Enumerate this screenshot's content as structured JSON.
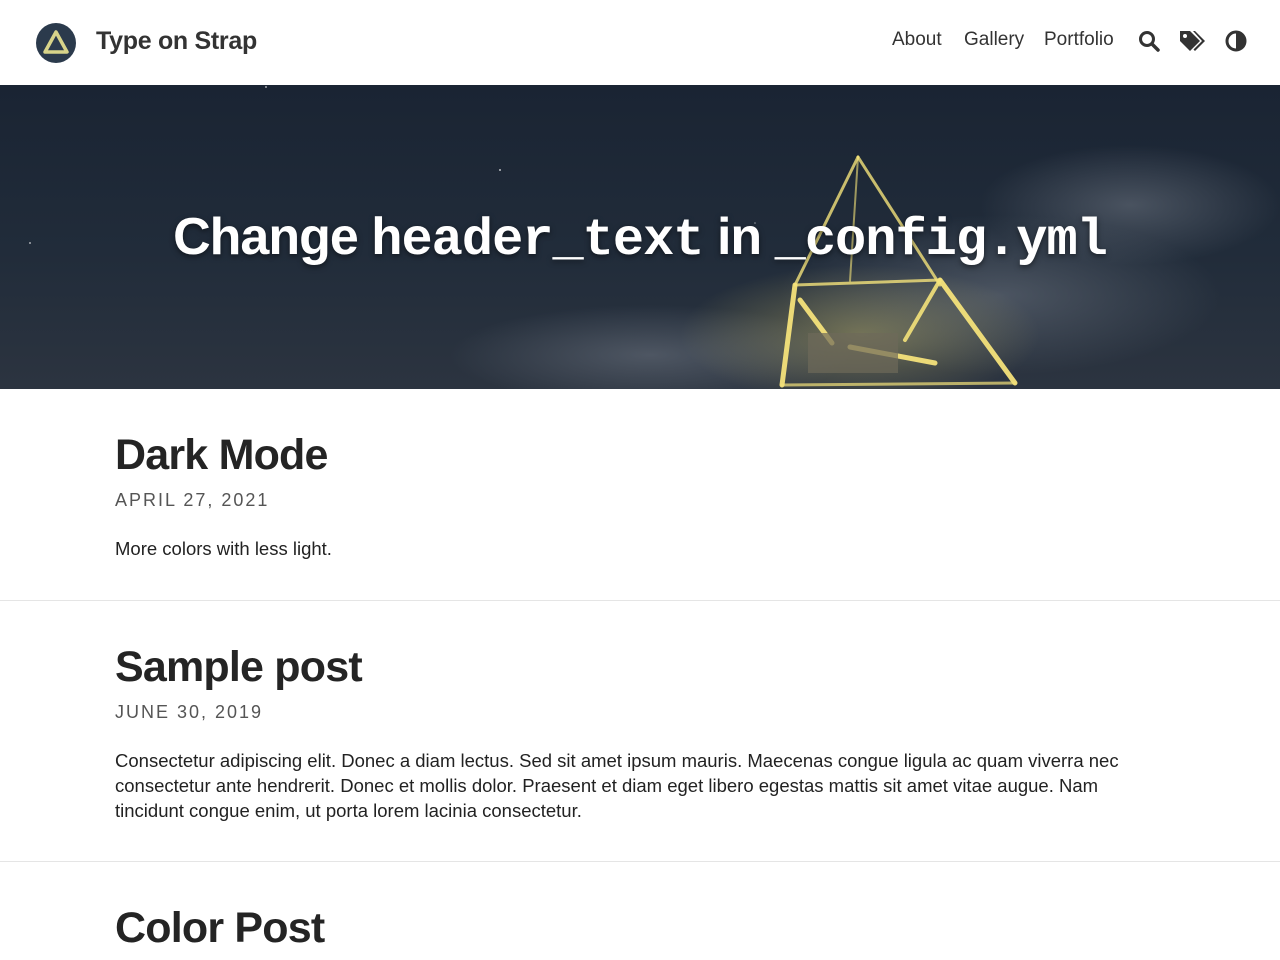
{
  "site": {
    "title": "Type on Strap"
  },
  "nav": {
    "links": [
      {
        "label": "About"
      },
      {
        "label": "Gallery"
      },
      {
        "label": "Portfolio"
      }
    ],
    "icons": [
      "search-icon",
      "tags-icon",
      "theme-toggle-icon"
    ]
  },
  "hero": {
    "text_before": "Change ",
    "code_1": "header_text",
    "text_middle": " in ",
    "code_2": "_config.yml"
  },
  "posts": [
    {
      "title": "Dark Mode",
      "date": "APRIL 27, 2021",
      "excerpt": "More colors with less light."
    },
    {
      "title": "Sample post",
      "date": "JUNE 30, 2019",
      "excerpt": "Consectetur adipiscing elit. Donec a diam lectus. Sed sit amet ipsum mauris. Maecenas congue ligula ac quam viverra nec consectetur ante hendrerit. Donec et mollis dolor. Praesent et diam eget libero egestas mattis sit amet vitae augue. Nam tincidunt congue enim, ut porta lorem lacinia consectetur."
    },
    {
      "title": "Color Post",
      "date": "",
      "excerpt": ""
    }
  ],
  "colors": {
    "logo_background": "#2b3a4c",
    "logo_triangle": "#d8d48a",
    "hero_background": "#1f2a38",
    "hero_light": "#f4e27a",
    "text": "#222222",
    "divider": "#e5e5e5"
  }
}
